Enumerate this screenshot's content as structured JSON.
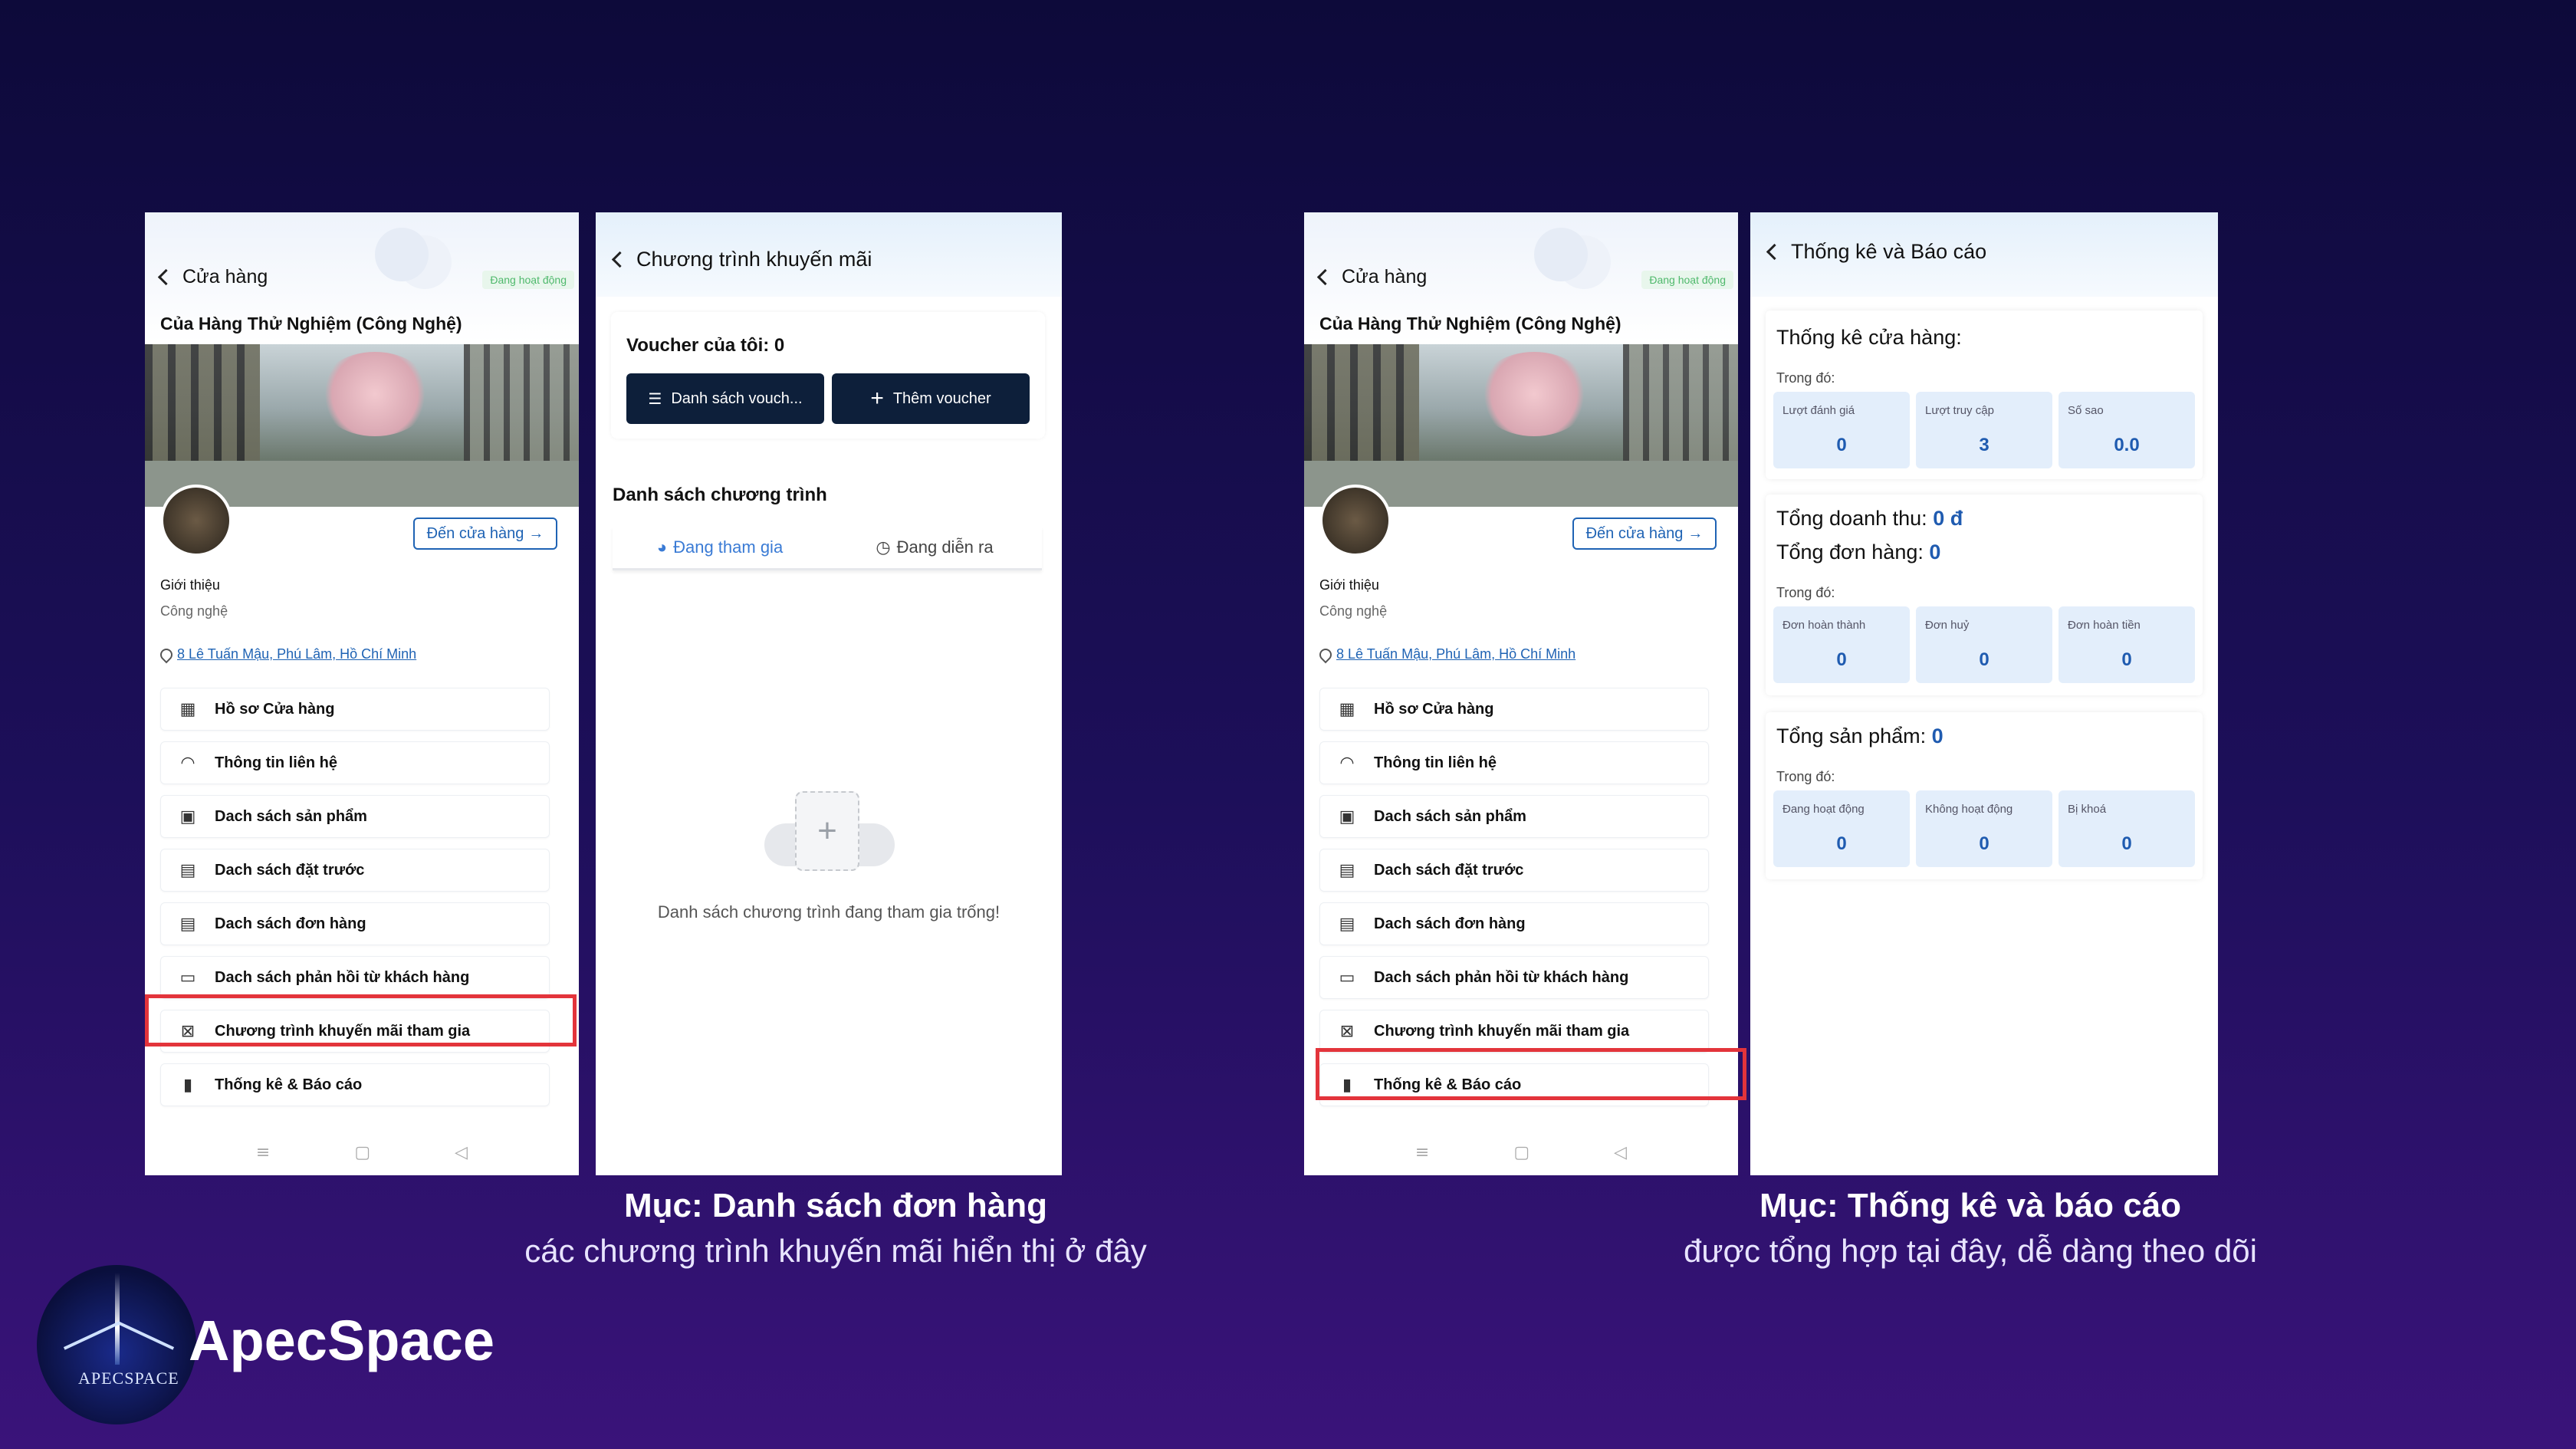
{
  "store_screen": {
    "back_label": "Cửa hàng",
    "status": "Đang hoạt động",
    "store_name": "Của Hàng Thử Nghiệm (Công Nghệ)",
    "goto_button": "Đến cửa hàng",
    "intro_label": "Giới thiệu",
    "intro_value": "Công nghệ",
    "address": "8 Lê Tuấn Mậu, Phú Lâm, Hồ Chí Minh",
    "menu": [
      {
        "label": "Hồ sơ Cửa hàng",
        "icon": "store-icon"
      },
      {
        "label": "Thông tin liên hệ",
        "icon": "headset-icon"
      },
      {
        "label": "Dach sách sản phẩm",
        "icon": "product-icon"
      },
      {
        "label": "Dach sách đặt trước",
        "icon": "preorder-icon"
      },
      {
        "label": "Dach sách đơn hàng",
        "icon": "order-icon"
      },
      {
        "label": "Dach sách phản hồi từ khách hàng",
        "icon": "feedback-icon"
      },
      {
        "label": "Chương trình khuyến mãi tham gia",
        "icon": "voucher-icon"
      },
      {
        "label": "Thống kê & Báo cáo",
        "icon": "chart-icon"
      }
    ]
  },
  "promo_screen": {
    "title": "Chương trình khuyến mãi",
    "voucher_title": "Voucher của tôi: 0",
    "list_button": "Danh sách vouch...",
    "add_button": "Thêm voucher",
    "list_heading": "Danh sách chương trình",
    "tab_joined": "Đang tham gia",
    "tab_ongoing": "Đang diễn ra",
    "empty_text": "Danh sách chương trình đang tham gia trống!"
  },
  "stats_screen": {
    "title": "Thống kê và Báo cáo",
    "store_stats": {
      "heading": "Thống kê cửa hàng:",
      "sub": "Trong đó:",
      "boxes": [
        {
          "label": "Lượt đánh giá",
          "value": "0"
        },
        {
          "label": "Lượt truy cập",
          "value": "3"
        },
        {
          "label": "Số sao",
          "value": "0.0"
        }
      ]
    },
    "revenue": {
      "revenue_label": "Tổng doanh thu:",
      "revenue_value": "0 đ",
      "orders_label": "Tổng đơn hàng:",
      "orders_value": "0",
      "sub": "Trong đó:",
      "boxes": [
        {
          "label": "Đơn hoàn thành",
          "value": "0"
        },
        {
          "label": "Đơn huỷ",
          "value": "0"
        },
        {
          "label": "Đơn hoàn tiền",
          "value": "0"
        }
      ]
    },
    "products": {
      "label": "Tổng sản phẩm:",
      "value": "0",
      "sub": "Trong đó:",
      "boxes": [
        {
          "label": "Đang hoạt động",
          "value": "0"
        },
        {
          "label": "Không hoạt động",
          "value": "0"
        },
        {
          "label": "Bị khoá",
          "value": "0"
        }
      ]
    }
  },
  "captions": {
    "left_title": "Mục: Danh sách đơn hàng",
    "left_sub": "các chương trình khuyến mãi hiển thị ở đây",
    "right_title": "Mục: Thống kê và báo cáo",
    "right_sub": "được tổng hợp tại đây, dễ dàng theo dõi"
  },
  "brand": {
    "name": "ApecSpace",
    "logo_text": "APECSPACE"
  },
  "colors": {
    "accent": "#1f63b4",
    "highlight": "#e3343b",
    "dark_button": "#0d1f3a"
  }
}
